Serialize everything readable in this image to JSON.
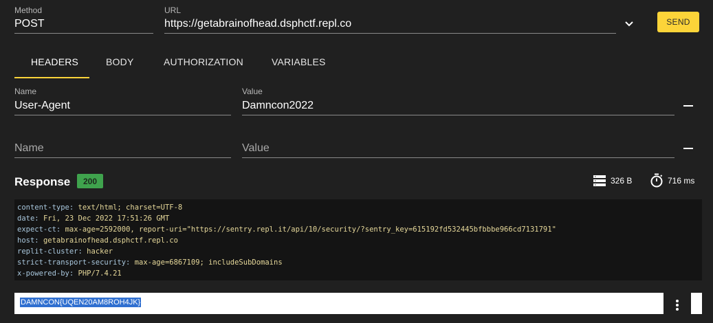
{
  "request": {
    "method_label": "Method",
    "method_value": "POST",
    "url_label": "URL",
    "url_value": "https://getabrainofhead.dsphctf.repl.co",
    "send_label": "SEND"
  },
  "tabs": [
    {
      "label": "HEADERS",
      "active": true
    },
    {
      "label": "BODY",
      "active": false
    },
    {
      "label": "AUTHORIZATION",
      "active": false
    },
    {
      "label": "VARIABLES",
      "active": false
    }
  ],
  "header_rows": [
    {
      "name_label": "Name",
      "name_value": "User-Agent",
      "value_label": "Value",
      "value_value": "Damncon2022"
    },
    {
      "name_placeholder": "Name",
      "value_placeholder": "Value"
    }
  ],
  "response": {
    "title": "Response",
    "status": "200",
    "size": "326 B",
    "time": "716 ms",
    "headers": [
      {
        "key": "content-type",
        "value": "text/html; charset=UTF-8"
      },
      {
        "key": "date",
        "value": "Fri, 23 Dec 2022 17:51:26 GMT"
      },
      {
        "key": "expect-ct",
        "value": "max-age=2592000, report-uri=\"https://sentry.repl.it/api/10/security/?sentry_key=615192fd532445bfbbbe966cd7131791\""
      },
      {
        "key": "host",
        "value": "getabrainofhead.dsphctf.repl.co"
      },
      {
        "key": "replit-cluster",
        "value": "hacker"
      },
      {
        "key": "strict-transport-security",
        "value": "max-age=6867109; includeSubDomains"
      },
      {
        "key": "x-powered-by",
        "value": "PHP/7.4.21"
      }
    ],
    "body": "DAMNCON{UQEN20AM8ROH4JK}"
  },
  "colors": {
    "background": "#202020",
    "accent": "#fcd439",
    "status_ok": "#3fa34d",
    "header_key": "#a9c7dd",
    "header_value": "#e6d89a"
  },
  "icons": {
    "dropdown": "chevron-down-icon",
    "remove": "minus-icon",
    "size": "storage-icon",
    "time": "stopwatch-icon",
    "more": "more-vertical-icon"
  }
}
